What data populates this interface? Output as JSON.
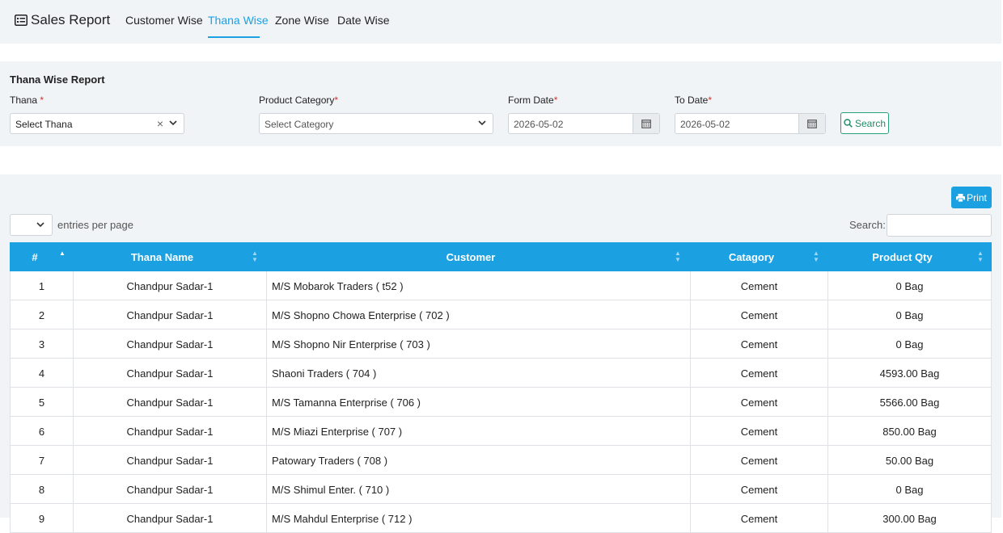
{
  "header": {
    "title": "Sales Report",
    "tabs": [
      {
        "label": "Customer Wise"
      },
      {
        "label": "Thana Wise"
      },
      {
        "label": "Zone Wise"
      },
      {
        "label": "Date Wise"
      }
    ],
    "active_tab": "Thana Wise"
  },
  "filters": {
    "title": "Thana Wise Report",
    "thana_label": "Thana",
    "thana_value": "Select Thana",
    "category_label": "Product Category",
    "category_value": "Select Category",
    "from_label": "Form Date",
    "from_value": "2026-05-02",
    "to_label": "To Date",
    "to_value": "2026-05-02",
    "required_mark": "*",
    "search_label": "Search"
  },
  "table_controls": {
    "print_label": "Print",
    "entries_label": "entries per page",
    "search_label": "Search:"
  },
  "table": {
    "columns": [
      "#",
      "Thana Name",
      "Customer",
      "Catagory",
      "Product Qty"
    ],
    "rows": [
      [
        "1",
        "Chandpur Sadar-1",
        "M/S Mobarok Traders ( t52 )",
        "Cement",
        "0 Bag"
      ],
      [
        "2",
        "Chandpur Sadar-1",
        "M/S Shopno Chowa Enterprise ( 702 )",
        "Cement",
        "0 Bag"
      ],
      [
        "3",
        "Chandpur Sadar-1",
        "M/S Shopno Nir Enterprise ( 703 )",
        "Cement",
        "0 Bag"
      ],
      [
        "4",
        "Chandpur Sadar-1",
        "Shaoni Traders ( 704 )",
        "Cement",
        "4593.00 Bag"
      ],
      [
        "5",
        "Chandpur Sadar-1",
        "M/S Tamanna Enterprise ( 706 )",
        "Cement",
        "5566.00 Bag"
      ],
      [
        "6",
        "Chandpur Sadar-1",
        "M/S Miazi Enterprise ( 707 )",
        "Cement",
        "850.00 Bag"
      ],
      [
        "7",
        "Chandpur Sadar-1",
        "Patowary Traders ( 708 )",
        "Cement",
        "50.00 Bag"
      ],
      [
        "8",
        "Chandpur Sadar-1",
        "M/S Shimul Enter. ( 710 )",
        "Cement",
        "0 Bag"
      ],
      [
        "9",
        "Chandpur Sadar-1",
        "M/S Mahdul Enterprise ( 712 )",
        "Cement",
        "300.00 Bag"
      ]
    ]
  },
  "colors": {
    "accent": "#1ba1e2",
    "panel": "#f1f4f7",
    "search_green": "#28a07a",
    "required": "#d9302c"
  },
  "icons": {
    "title": "report-card-icon",
    "calendar": "calendar-icon",
    "search": "search-icon",
    "print": "printer-icon",
    "chevron": "chevron-down-icon",
    "clear": "close-icon"
  }
}
